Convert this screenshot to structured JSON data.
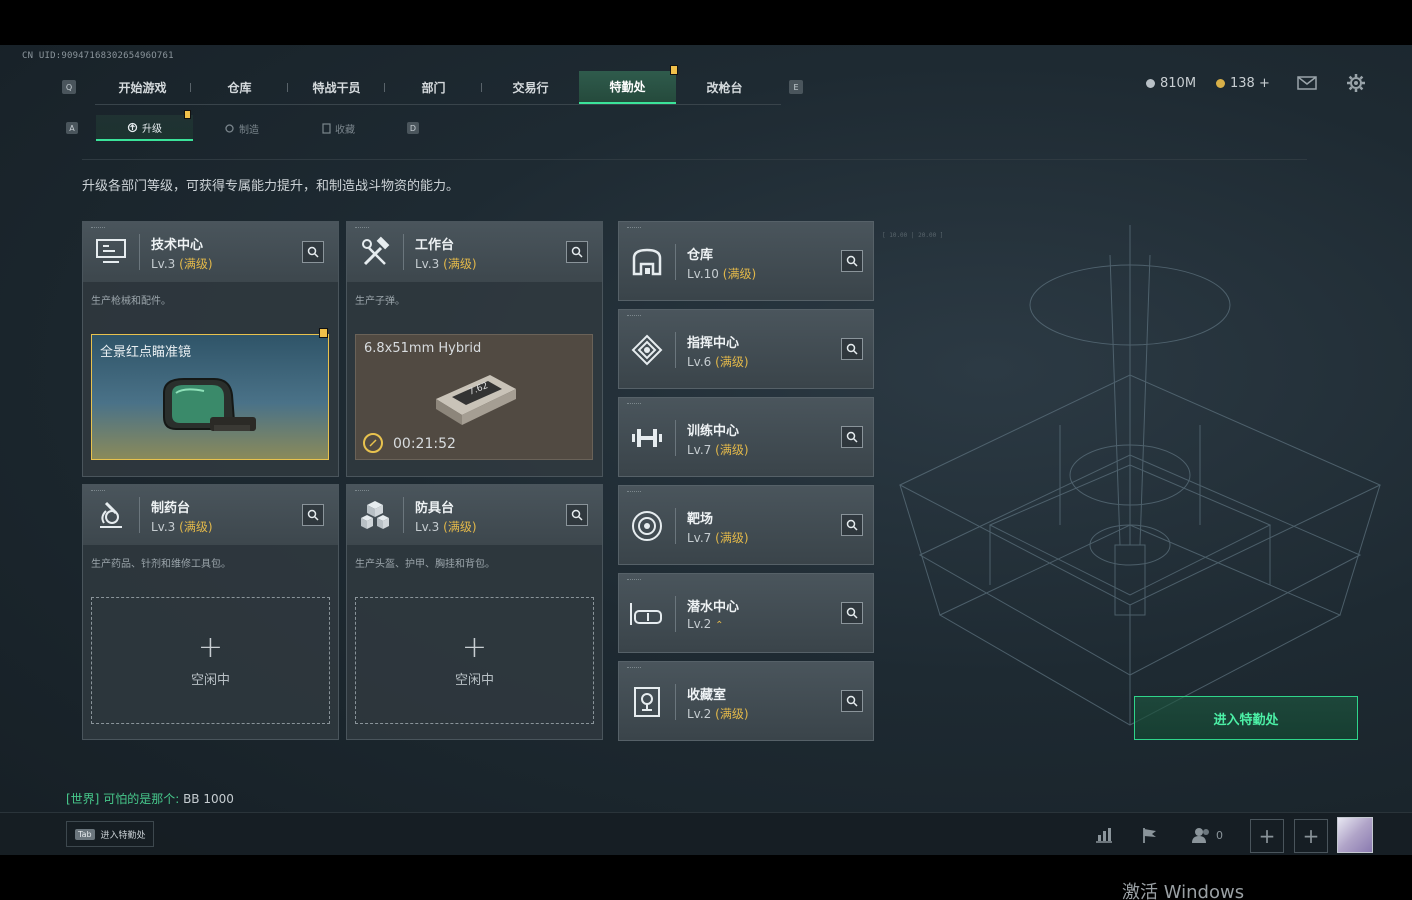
{
  "uid": "CN UID:9094716830265496O761",
  "nav": {
    "left_key": "Q",
    "right_key": "E",
    "tabs": [
      {
        "label": "开始游戏"
      },
      {
        "label": "仓库"
      },
      {
        "label": "特战干员"
      },
      {
        "label": "部门"
      },
      {
        "label": "交易行"
      },
      {
        "label": "特勤处",
        "active": true
      },
      {
        "label": "改枪台"
      }
    ]
  },
  "currency": {
    "silver": "810M",
    "gold": "138 +"
  },
  "subnav": {
    "left_key": "A",
    "right_key": "D",
    "tabs": [
      {
        "label": "升级",
        "active": true
      },
      {
        "label": "制造"
      },
      {
        "label": "收藏"
      }
    ]
  },
  "description": "升级各部门等级，可获得专属能力提升，和制造战斗物资的能力。",
  "cards": [
    {
      "title": "技术中心",
      "lv": "Lv.3",
      "max": "(满级)",
      "desc": "生产枪械和配件。",
      "slot": {
        "kind": "product",
        "name": "全景红点瞄准镜"
      }
    },
    {
      "title": "工作台",
      "lv": "Lv.3",
      "max": "(满级)",
      "desc": "生产子弹。",
      "slot": {
        "kind": "timer",
        "name": "6.8x51mm Hybrid",
        "timer": "00:21:52"
      }
    },
    {
      "title": "制药台",
      "lv": "Lv.3",
      "max": "(满级)",
      "desc": "生产药品、针剂和维修工具包。",
      "slot": {
        "kind": "empty",
        "label": "空闲中"
      }
    },
    {
      "title": "防具台",
      "lv": "Lv.3",
      "max": "(满级)",
      "desc": "生产头盔、护甲、胸挂和背包。",
      "slot": {
        "kind": "empty",
        "label": "空闲中"
      }
    }
  ],
  "mini_cards": [
    {
      "title": "仓库",
      "lv": "Lv.10",
      "max": "(满级)",
      "icon": "warehouse-icon"
    },
    {
      "title": "指挥中心",
      "lv": "Lv.6",
      "max": "(满级)",
      "icon": "command-icon"
    },
    {
      "title": "训练中心",
      "lv": "Lv.7",
      "max": "(满级)",
      "icon": "dumbbell-icon"
    },
    {
      "title": "靶场",
      "lv": "Lv.7",
      "max": "(满级)",
      "icon": "target-icon"
    },
    {
      "title": "潜水中心",
      "lv": "Lv.2",
      "max": "",
      "icon": "diving-mask-icon"
    },
    {
      "title": "收藏室",
      "lv": "Lv.2",
      "max": "(满级)",
      "icon": "trophy-icon"
    }
  ],
  "enter_button": "进入特勤处",
  "chat": {
    "channel": "[世界]",
    "user": "可怕的是那个:",
    "message": "BB   1000"
  },
  "footer": {
    "tab_key": "Tab",
    "tab_hint": "进入特勤处",
    "friends_count": "0"
  },
  "watermark": "激活 Windows",
  "colors": {
    "accent": "#3be39a",
    "max_level": "#e2b84a",
    "marker": "#f0c04a"
  }
}
